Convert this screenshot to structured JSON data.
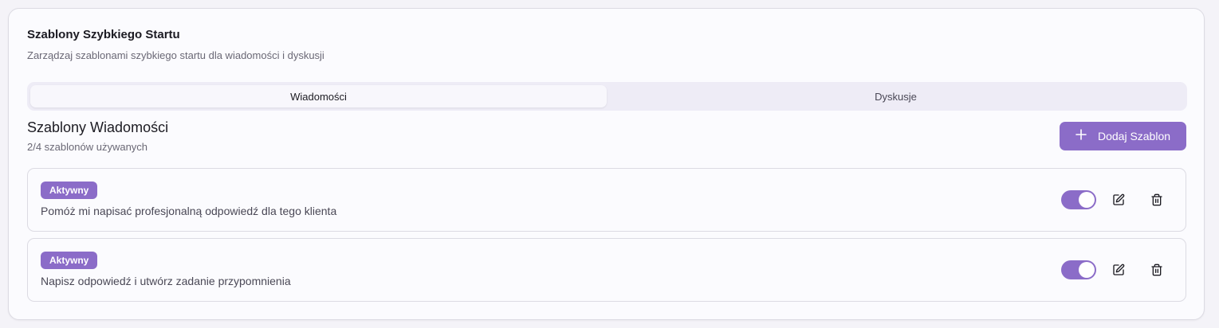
{
  "header": {
    "title": "Szablony Szybkiego Startu",
    "subtitle": "Zarządzaj szablonami szybkiego startu dla wiadomości i dyskusji"
  },
  "tabs": [
    {
      "label": "Wiadomości",
      "active": true
    },
    {
      "label": "Dyskusje",
      "active": false
    }
  ],
  "section": {
    "title": "Szablony Wiadomości",
    "usage": "2/4 szablonów używanych",
    "add_label": "Dodaj Szablon",
    "add_icon": "plus-icon"
  },
  "templates": [
    {
      "badge": "Aktywny",
      "text": "Pomóż mi napisać profesjonalną odpowiedź dla tego klienta",
      "enabled": true
    },
    {
      "badge": "Aktywny",
      "text": "Napisz odpowiedź i utwórz zadanie przypomnienia",
      "enabled": true
    }
  ],
  "colors": {
    "accent": "#8b6cc8",
    "background": "#f4f3f8",
    "card": "#fbfbfe",
    "tab_track": "#eeecf6"
  },
  "icons": {
    "edit": "edit-icon",
    "delete": "trash-icon"
  }
}
